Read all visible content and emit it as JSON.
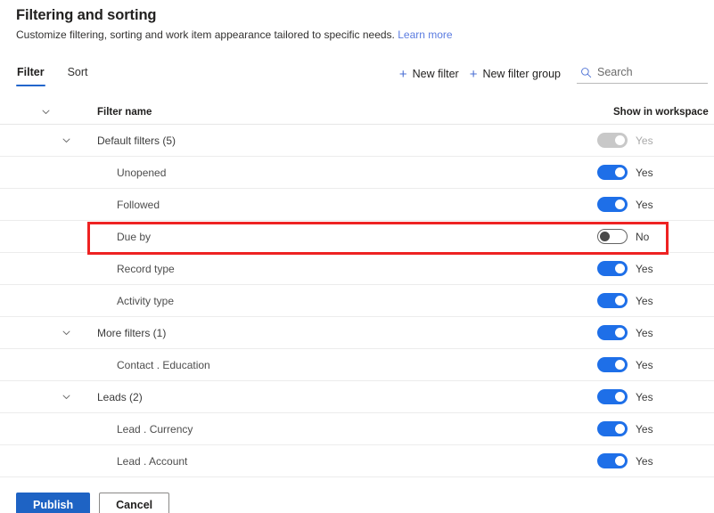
{
  "header": {
    "title": "Filtering and sorting",
    "subtitle": "Customize filtering, sorting and work item appearance tailored to specific needs.",
    "learn_more": "Learn more"
  },
  "tabs": [
    {
      "label": "Filter",
      "active": true
    },
    {
      "label": "Sort",
      "active": false
    }
  ],
  "commandbar": {
    "new_filter": "New filter",
    "new_filter_group": "New filter group",
    "plus_icon": "plus-icon",
    "search_icon": "search-icon",
    "search_value": "",
    "search_placeholder": "Search"
  },
  "table": {
    "columns": {
      "filter_name": "Filter name",
      "show_in_workspace": "Show in workspace"
    },
    "rows": [
      {
        "name": "Default filters (5)",
        "level": "group",
        "chevron": true,
        "toggle": "disabled",
        "toggle_label": "Yes",
        "highlighted": false
      },
      {
        "name": "Unopened",
        "level": "child",
        "chevron": false,
        "toggle": "on",
        "toggle_label": "Yes",
        "highlighted": false
      },
      {
        "name": "Followed",
        "level": "child",
        "chevron": false,
        "toggle": "on",
        "toggle_label": "Yes",
        "highlighted": false
      },
      {
        "name": "Due by",
        "level": "child",
        "chevron": false,
        "toggle": "off",
        "toggle_label": "No",
        "highlighted": true
      },
      {
        "name": "Record type",
        "level": "child",
        "chevron": false,
        "toggle": "on",
        "toggle_label": "Yes",
        "highlighted": false
      },
      {
        "name": "Activity type",
        "level": "child",
        "chevron": false,
        "toggle": "on",
        "toggle_label": "Yes",
        "highlighted": false
      },
      {
        "name": "More filters (1)",
        "level": "group",
        "chevron": true,
        "toggle": "on",
        "toggle_label": "Yes",
        "highlighted": false
      },
      {
        "name": "Contact . Education",
        "level": "child",
        "chevron": false,
        "toggle": "on",
        "toggle_label": "Yes",
        "highlighted": false
      },
      {
        "name": "Leads (2)",
        "level": "group",
        "chevron": true,
        "toggle": "on",
        "toggle_label": "Yes",
        "highlighted": false
      },
      {
        "name": "Lead . Currency",
        "level": "child",
        "chevron": false,
        "toggle": "on",
        "toggle_label": "Yes",
        "highlighted": false
      },
      {
        "name": "Lead . Account",
        "level": "child",
        "chevron": false,
        "toggle": "on",
        "toggle_label": "Yes",
        "highlighted": false
      }
    ]
  },
  "footer": {
    "publish": "Publish",
    "cancel": "Cancel"
  },
  "colors": {
    "accent": "#1e6fe8",
    "primary_button": "#1e63c4",
    "link": "#5b7ce0",
    "highlight": "#ee2222",
    "toggle_off_border": "#646464",
    "toggle_disabled": "#c8c8c8"
  }
}
